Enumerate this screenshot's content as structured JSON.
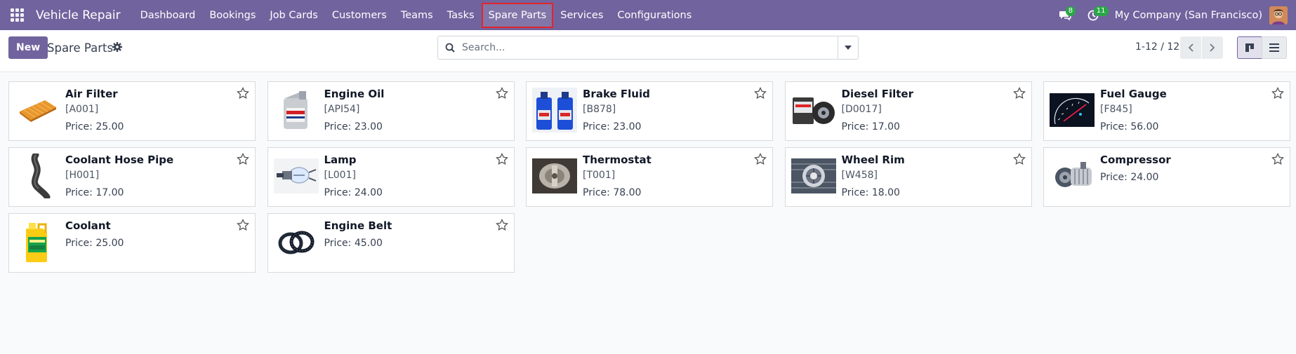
{
  "app": {
    "brand": "Vehicle Repair"
  },
  "menu": [
    {
      "label": "Dashboard"
    },
    {
      "label": "Bookings"
    },
    {
      "label": "Job Cards"
    },
    {
      "label": "Customers"
    },
    {
      "label": "Teams"
    },
    {
      "label": "Tasks"
    },
    {
      "label": "Spare Parts",
      "active": true
    },
    {
      "label": "Services"
    },
    {
      "label": "Configurations"
    }
  ],
  "systray": {
    "messages_count": "8",
    "activity_count": "11",
    "company": "My Company (San Francisco)"
  },
  "control": {
    "new_label": "New",
    "title": "Spare Parts",
    "search_placeholder": "Search...",
    "pager": "1-12 / 12"
  },
  "colors": {
    "brand": "#71639e",
    "active_outline": "#e0252b",
    "badge": "#28a745"
  },
  "products": [
    {
      "name": "Air Filter",
      "code": "[A001]",
      "price": "Price: 25.00",
      "icon": "air-filter-image"
    },
    {
      "name": "Engine Oil",
      "code": "[API54]",
      "price": "Price: 23.00",
      "icon": "engine-oil-image"
    },
    {
      "name": "Brake Fluid",
      "code": "[B878]",
      "price": "Price: 23.00",
      "icon": "brake-fluid-image"
    },
    {
      "name": "Diesel Filter",
      "code": "[D0017]",
      "price": "Price: 17.00",
      "icon": "diesel-filter-image"
    },
    {
      "name": "Fuel Gauge",
      "code": "[F845]",
      "price": "Price: 56.00",
      "icon": "fuel-gauge-image"
    },
    {
      "name": "Coolant Hose Pipe",
      "code": "[H001]",
      "price": "Price: 17.00",
      "icon": "hose-pipe-image"
    },
    {
      "name": "Lamp",
      "code": "[L001]",
      "price": "Price: 24.00",
      "icon": "lamp-image"
    },
    {
      "name": "Thermostat",
      "code": "[T001]",
      "price": "Price: 78.00",
      "icon": "thermostat-image"
    },
    {
      "name": "Wheel Rim",
      "code": "[W458]",
      "price": "Price: 18.00",
      "icon": "wheel-rim-image"
    },
    {
      "name": "Compressor",
      "code": "",
      "price": "Price: 24.00",
      "icon": "compressor-image"
    },
    {
      "name": "Coolant",
      "code": "",
      "price": "Price: 25.00",
      "icon": "coolant-image"
    },
    {
      "name": "Engine Belt",
      "code": "",
      "price": "Price: 45.00",
      "icon": "engine-belt-image"
    }
  ]
}
